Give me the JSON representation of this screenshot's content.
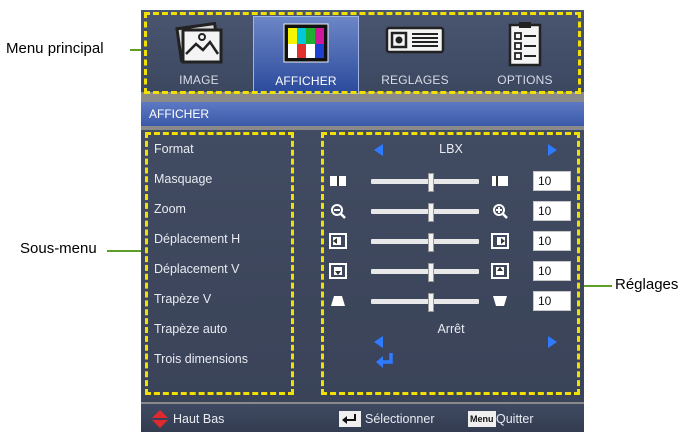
{
  "annotations": {
    "main_menu": "Menu principal",
    "sub_menu": "Sous-menu",
    "settings": "Réglages"
  },
  "tabs": [
    {
      "label": "IMAGE",
      "icon": "image-icon"
    },
    {
      "label": "AFFICHER",
      "icon": "color-bars-icon",
      "active": true
    },
    {
      "label": "REGLAGES",
      "icon": "projector-icon"
    },
    {
      "label": "OPTIONS",
      "icon": "checklist-icon"
    }
  ],
  "section_title": "AFFICHER",
  "items": [
    {
      "label": "Format",
      "control": "selector",
      "value": "LBX"
    },
    {
      "label": "Masquage",
      "control": "slider",
      "value": "10",
      "level": 0.55,
      "icon": "overscan-icon"
    },
    {
      "label": "Zoom",
      "control": "slider",
      "value": "10",
      "level": 0.55,
      "icon": "zoom-icon"
    },
    {
      "label": "Déplacement H",
      "control": "slider",
      "value": "10",
      "level": 0.55,
      "icon": "h-shift-icon"
    },
    {
      "label": "Déplacement V",
      "control": "slider",
      "value": "10",
      "level": 0.55,
      "icon": "v-shift-icon"
    },
    {
      "label": "Trapèze V",
      "control": "slider",
      "value": "10",
      "level": 0.55,
      "icon": "keystone-icon"
    },
    {
      "label": "Trapèze auto",
      "control": "selector",
      "value": "Arrêt"
    },
    {
      "label": "Trois dimensions",
      "control": "enter"
    }
  ],
  "footer": {
    "nav": "Haut Bas",
    "select": "Sélectionner",
    "menu_key": "Menu",
    "quit": "Quitter"
  },
  "colors": {
    "annotation_line": "#5f9e2a",
    "highlight_dash": "#f2e100",
    "arrow_blue": "#2f7bff",
    "nav_red": "#e0292f"
  }
}
